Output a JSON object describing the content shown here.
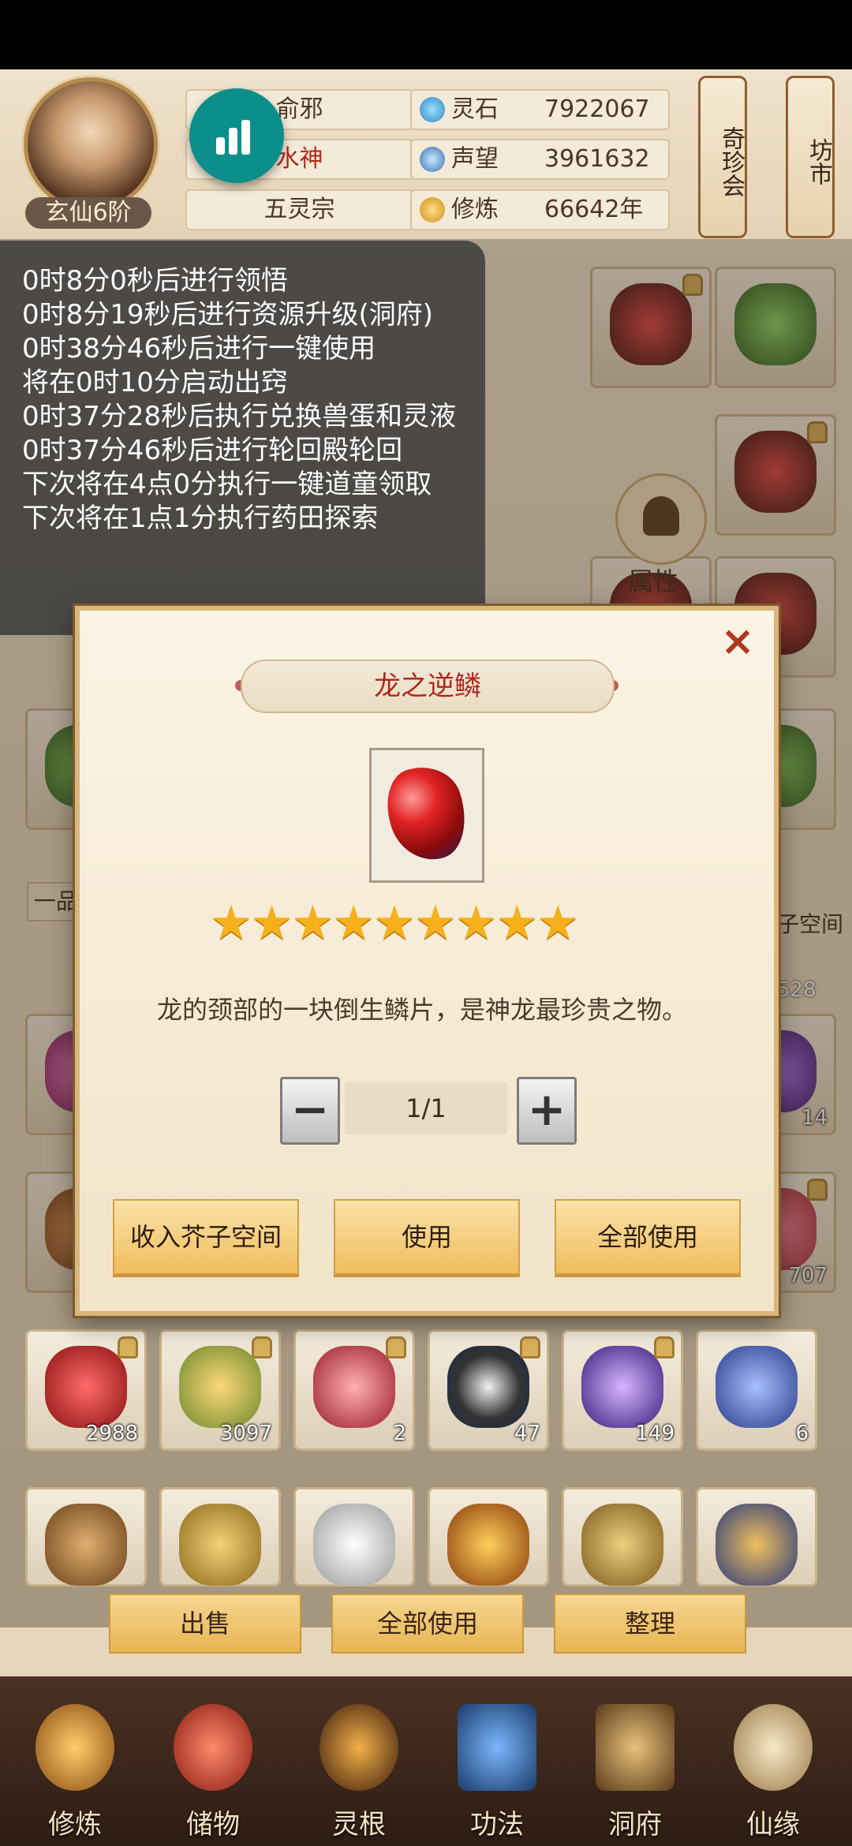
{
  "header": {
    "rank": "玄仙6阶",
    "name_rows": [
      "俞邪",
      "水神",
      "五灵宗"
    ],
    "resources": [
      {
        "label": "灵石",
        "value": "7922067",
        "icon": "spirit-stone-icon"
      },
      {
        "label": "声望",
        "value": "3961632",
        "icon": "reputation-icon"
      },
      {
        "label": "修炼",
        "value": "66642年",
        "icon": "cultivation-icon"
      }
    ],
    "scrolls": [
      "奇珍会",
      "坊市"
    ]
  },
  "log": {
    "lines": [
      "0时8分0秒后进行领悟",
      "0时8分19秒后进行资源升级(洞府)",
      "0时38分46秒后进行一键使用",
      "将在0时10分启动出窍",
      "0时37分28秒后执行兑换兽蛋和灵液",
      "0时37分46秒后进行轮回殿轮回",
      "下次将在4点0分执行一键道童领取",
      "下次将在1点1分执行药田探索"
    ]
  },
  "background": {
    "attr_label": "属性",
    "tab_label": "一品",
    "space_label": "子空间",
    "counts": [
      "528",
      "14",
      "707"
    ],
    "bottom_row_counts": [
      "2988",
      "3097",
      "2",
      "47",
      "149",
      "6"
    ]
  },
  "dialog": {
    "title": "龙之逆鳞",
    "close": "×",
    "stars": "★★★★★★★★★",
    "star_count": 9,
    "description": "龙的颈部的一块倒生鳞片，是神龙最珍贵之物。",
    "minus": "−",
    "plus": "+",
    "quantity": "1/1",
    "buttons": [
      "收入芥子空间",
      "使用",
      "全部使用"
    ]
  },
  "actions": [
    "出售",
    "全部使用",
    "整理"
  ],
  "nav": [
    "修炼",
    "储物",
    "灵根",
    "功法",
    "洞府",
    "仙缘"
  ],
  "colors": {
    "accent_gold": "#efbd5c",
    "title_red": "#b0281b",
    "fab_teal": "#0c8f8a"
  }
}
